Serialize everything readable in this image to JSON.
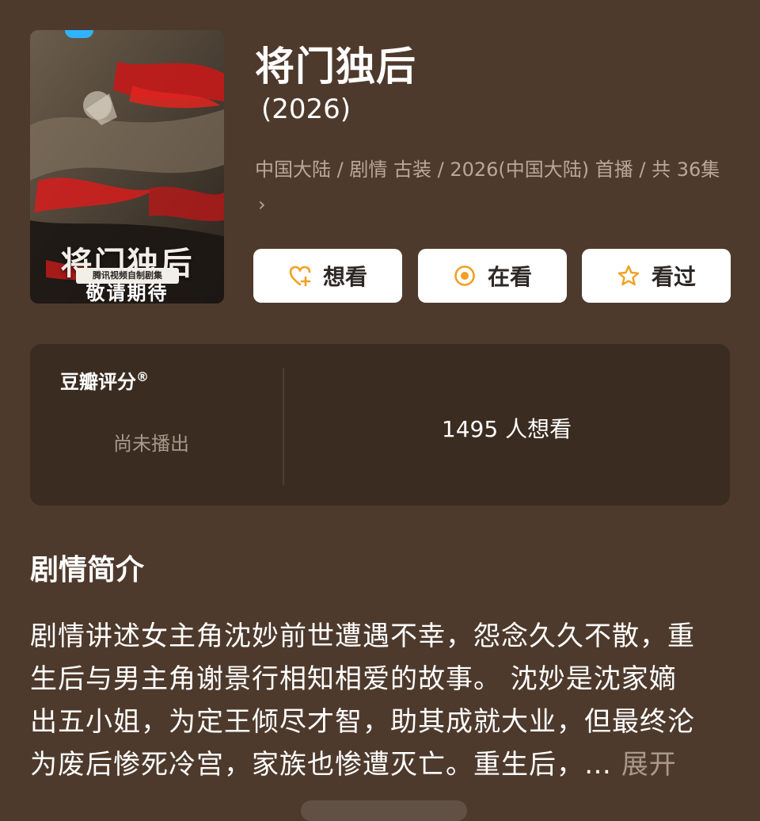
{
  "poster": {
    "title": "将门独后",
    "sub_label": "腾讯视频自制剧集",
    "coming_soon": "敬请期待"
  },
  "header": {
    "title": "将门独后",
    "year": "(2026)",
    "meta": "中国大陆 / 剧情 古装 / 2026(中国大陆) 首播 / 共 36集",
    "meta_chevron": "›"
  },
  "actions": {
    "want": "想看",
    "watching": "在看",
    "watched": "看过"
  },
  "rating": {
    "label": "豆瓣评分",
    "registered_mark": "®",
    "status": "尚未播出",
    "want_count": "1495 人想看"
  },
  "synopsis": {
    "heading": "剧情简介",
    "lines": [
      "剧情讲述女主角沈妙前世遭遇不幸，怨念久久不散，重",
      "生后与男主角谢景行相知相爱的故事。 沈妙是沈家嫡",
      "出五小姐，为定王倾尽才智，助其成就大业，但最终沦",
      "为废后惨死冷宫，家族也惨遭灭亡。重生后，… "
    ],
    "expand": "展开"
  },
  "colors": {
    "background": "#4e3a2c",
    "card": "#3b2c21",
    "accent_orange": "#f0a020",
    "muted_text": "#b7a898"
  },
  "icons": {
    "want": "heart-plus-icon",
    "watching": "target-circle-icon",
    "watched": "star-icon"
  }
}
